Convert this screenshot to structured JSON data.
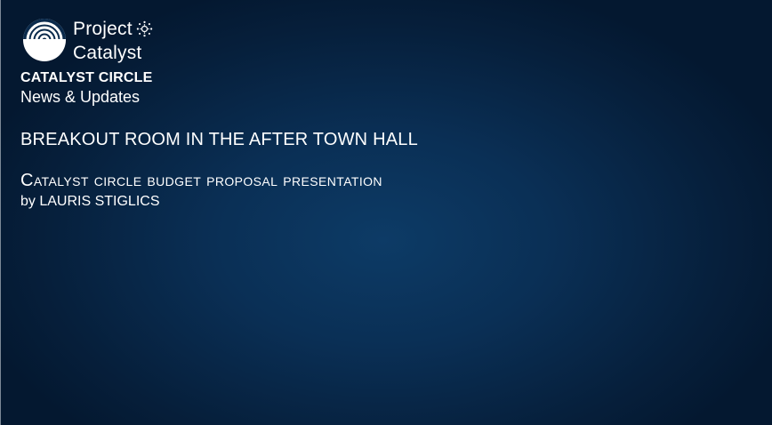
{
  "brand": {
    "line1": "Project",
    "line2": "Catalyst",
    "logo_icon": "project-catalyst-logo-icon",
    "sun_icon": "cardano-sun-icon"
  },
  "section": {
    "title": "CATALYST CIRCLE",
    "subtitle": "News & Updates"
  },
  "headline": "BREAKOUT ROOM IN THE AFTER TOWN HALL",
  "talk": {
    "title": "Catalyst circle budget proposal presentation",
    "author": "by LAURIS STIGLICS"
  },
  "colors": {
    "background": "#06223f",
    "text": "#ffffff"
  }
}
